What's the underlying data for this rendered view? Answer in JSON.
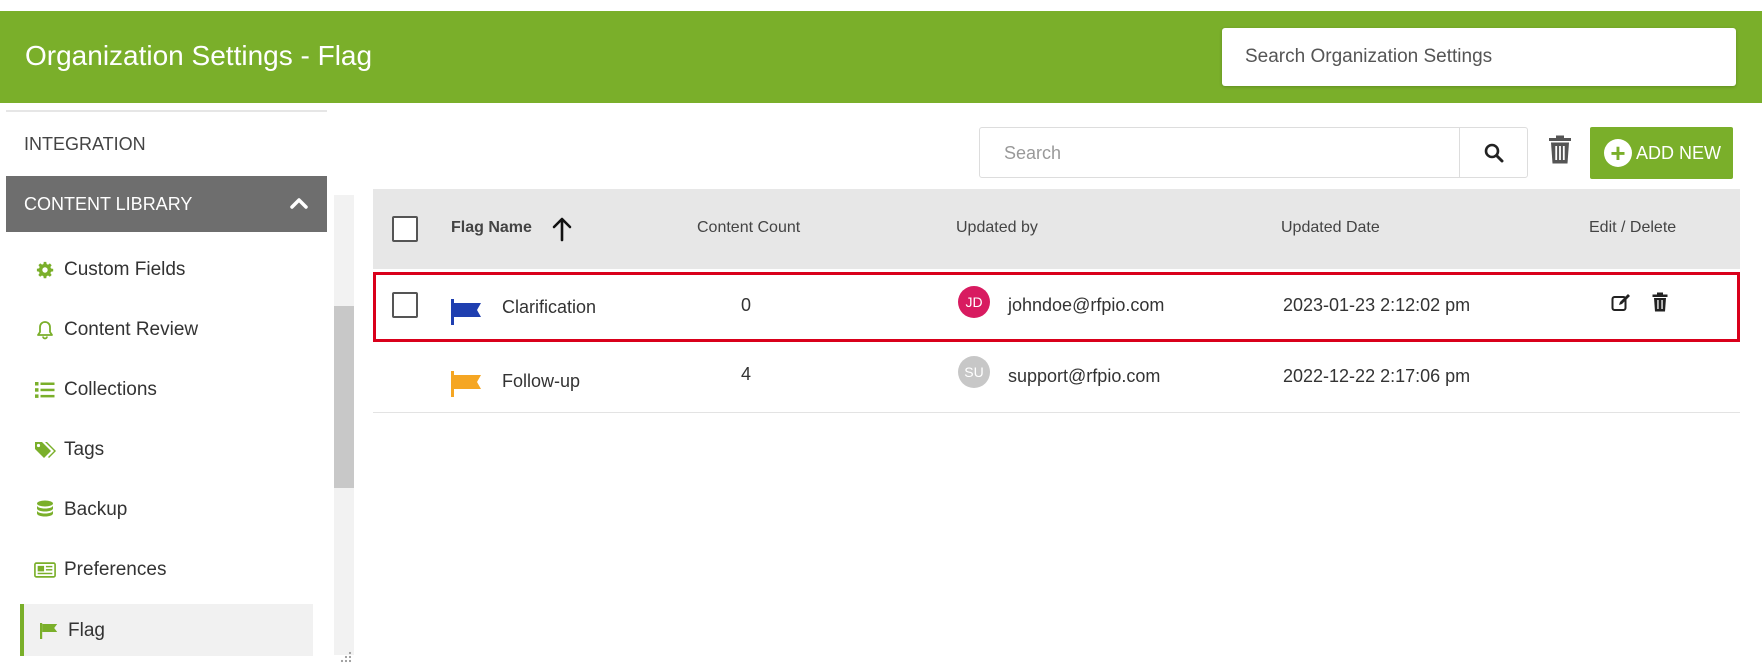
{
  "header": {
    "title": "Organization Settings - Flag",
    "search_placeholder": "Search Organization Settings"
  },
  "sidebar": {
    "integration_label": "INTEGRATION",
    "section_label": "CONTENT LIBRARY",
    "items": [
      {
        "label": "Custom Fields",
        "icon": "gear-icon"
      },
      {
        "label": "Content Review",
        "icon": "bell-icon"
      },
      {
        "label": "Collections",
        "icon": "list-icon"
      },
      {
        "label": "Tags",
        "icon": "tags-icon"
      },
      {
        "label": "Backup",
        "icon": "database-icon"
      },
      {
        "label": "Preferences",
        "icon": "newspaper-icon"
      },
      {
        "label": "Flag",
        "icon": "flag-icon",
        "active": true
      }
    ]
  },
  "toolbar": {
    "search_placeholder": "Search",
    "add_new_label": "ADD NEW"
  },
  "table": {
    "columns": {
      "flag_name": "Flag Name",
      "content_count": "Content Count",
      "updated_by": "Updated by",
      "updated_date": "Updated Date",
      "edit_delete": "Edit / Delete"
    },
    "rows": [
      {
        "flag_name": "Clarification",
        "flag_color": "#1f3fb0",
        "content_count": "0",
        "avatar_initials": "JD",
        "avatar_color": "#d81b60",
        "updated_by": "johndoe@rfpio.com",
        "updated_date": "2023-01-23 2:12:02 pm"
      },
      {
        "flag_name": "Follow-up",
        "flag_color": "#f5a623",
        "content_count": "4",
        "avatar_initials": "SU",
        "avatar_color": "#c7c7c7",
        "updated_by": "support@rfpio.com",
        "updated_date": "2022-12-22 2:17:06 pm"
      }
    ]
  },
  "colors": {
    "brand": "#7aaf2a",
    "highlight": "#d9001b"
  }
}
